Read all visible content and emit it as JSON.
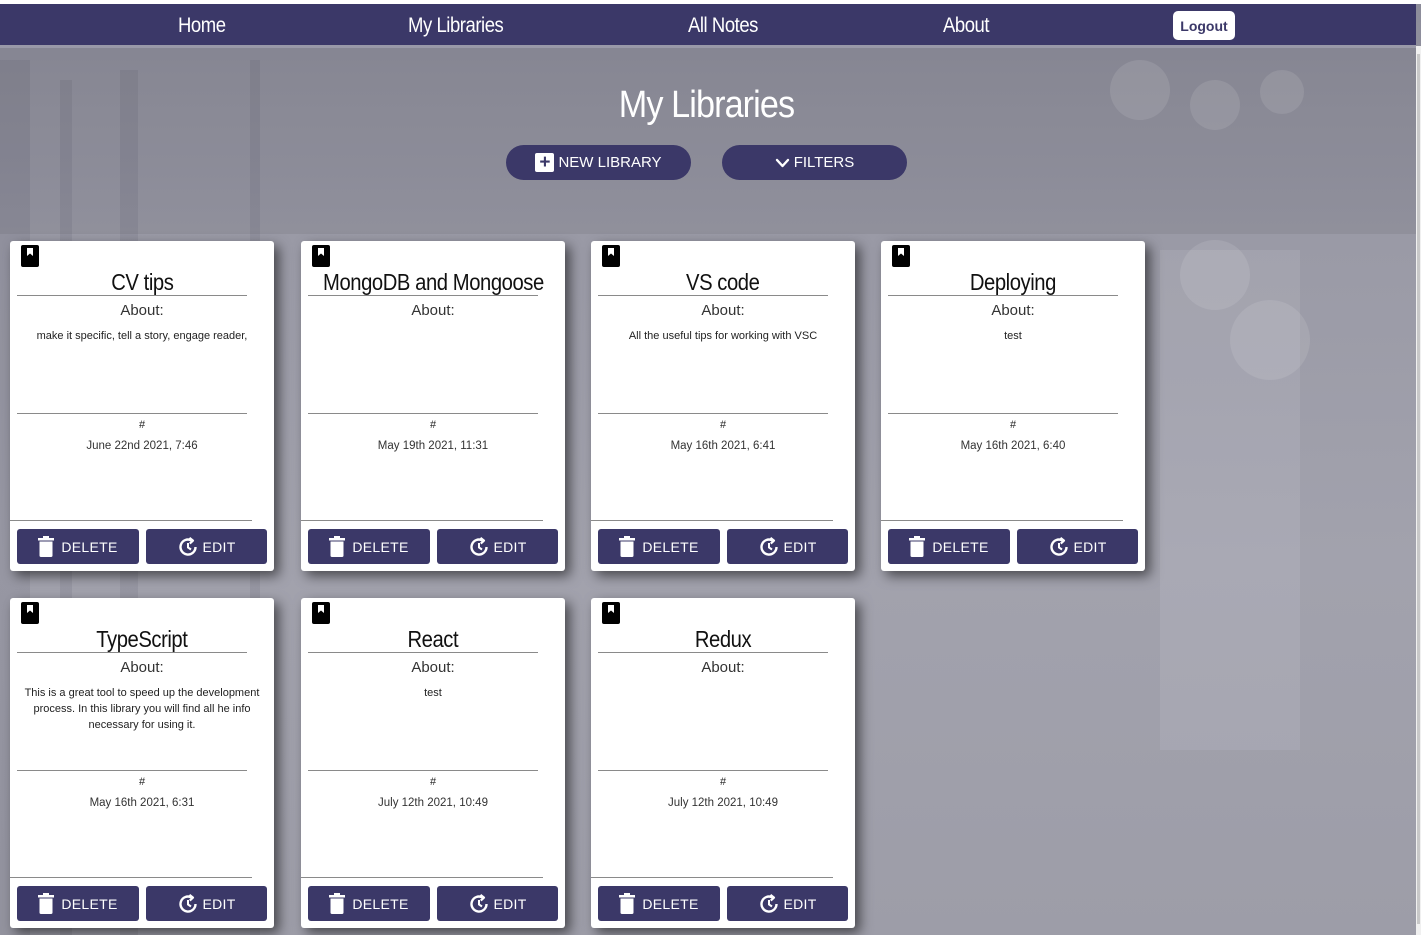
{
  "nav": {
    "links": [
      {
        "label": "Home"
      },
      {
        "label": "My Libraries"
      },
      {
        "label": "All Notes"
      },
      {
        "label": "About"
      }
    ],
    "logout_label": "Logout"
  },
  "page": {
    "title": "My Libraries",
    "new_library_label": "NEW LIBRARY",
    "filters_label": "FILTERS"
  },
  "card_labels": {
    "about": "About:",
    "hash": "#",
    "delete": "DELETE",
    "edit": "EDIT"
  },
  "libraries": [
    {
      "title": "CV tips",
      "about": "make it specific, tell a story, engage reader,",
      "date": "June 22nd 2021, 7:46"
    },
    {
      "title": "MongoDB and Mongoose",
      "about": "",
      "date": "May 19th 2021, 11:31"
    },
    {
      "title": "VS code",
      "about": "All the useful tips for working with VSC",
      "date": "May 16th 2021, 6:41"
    },
    {
      "title": "Deploying",
      "about": "test",
      "date": "May 16th 2021, 6:40"
    },
    {
      "title": "TypeScript",
      "about": "This is a great tool to speed up the development process. In this library you will find all he info necessary for using it.",
      "date": "May 16th 2021, 6:31"
    },
    {
      "title": "React",
      "about": "test",
      "date": "July 12th 2021, 10:49"
    },
    {
      "title": "Redux",
      "about": "",
      "date": "July 12th 2021, 10:49"
    }
  ],
  "icons": {
    "card": "bookmark-icon",
    "delete": "trash-icon",
    "edit": "edit-icon",
    "new_library": "plus-icon",
    "filters": "chevron-down-icon"
  },
  "colors": {
    "primary": "#3b3868",
    "card_bg": "#ffffff",
    "text_on_primary": "#ffffff"
  }
}
